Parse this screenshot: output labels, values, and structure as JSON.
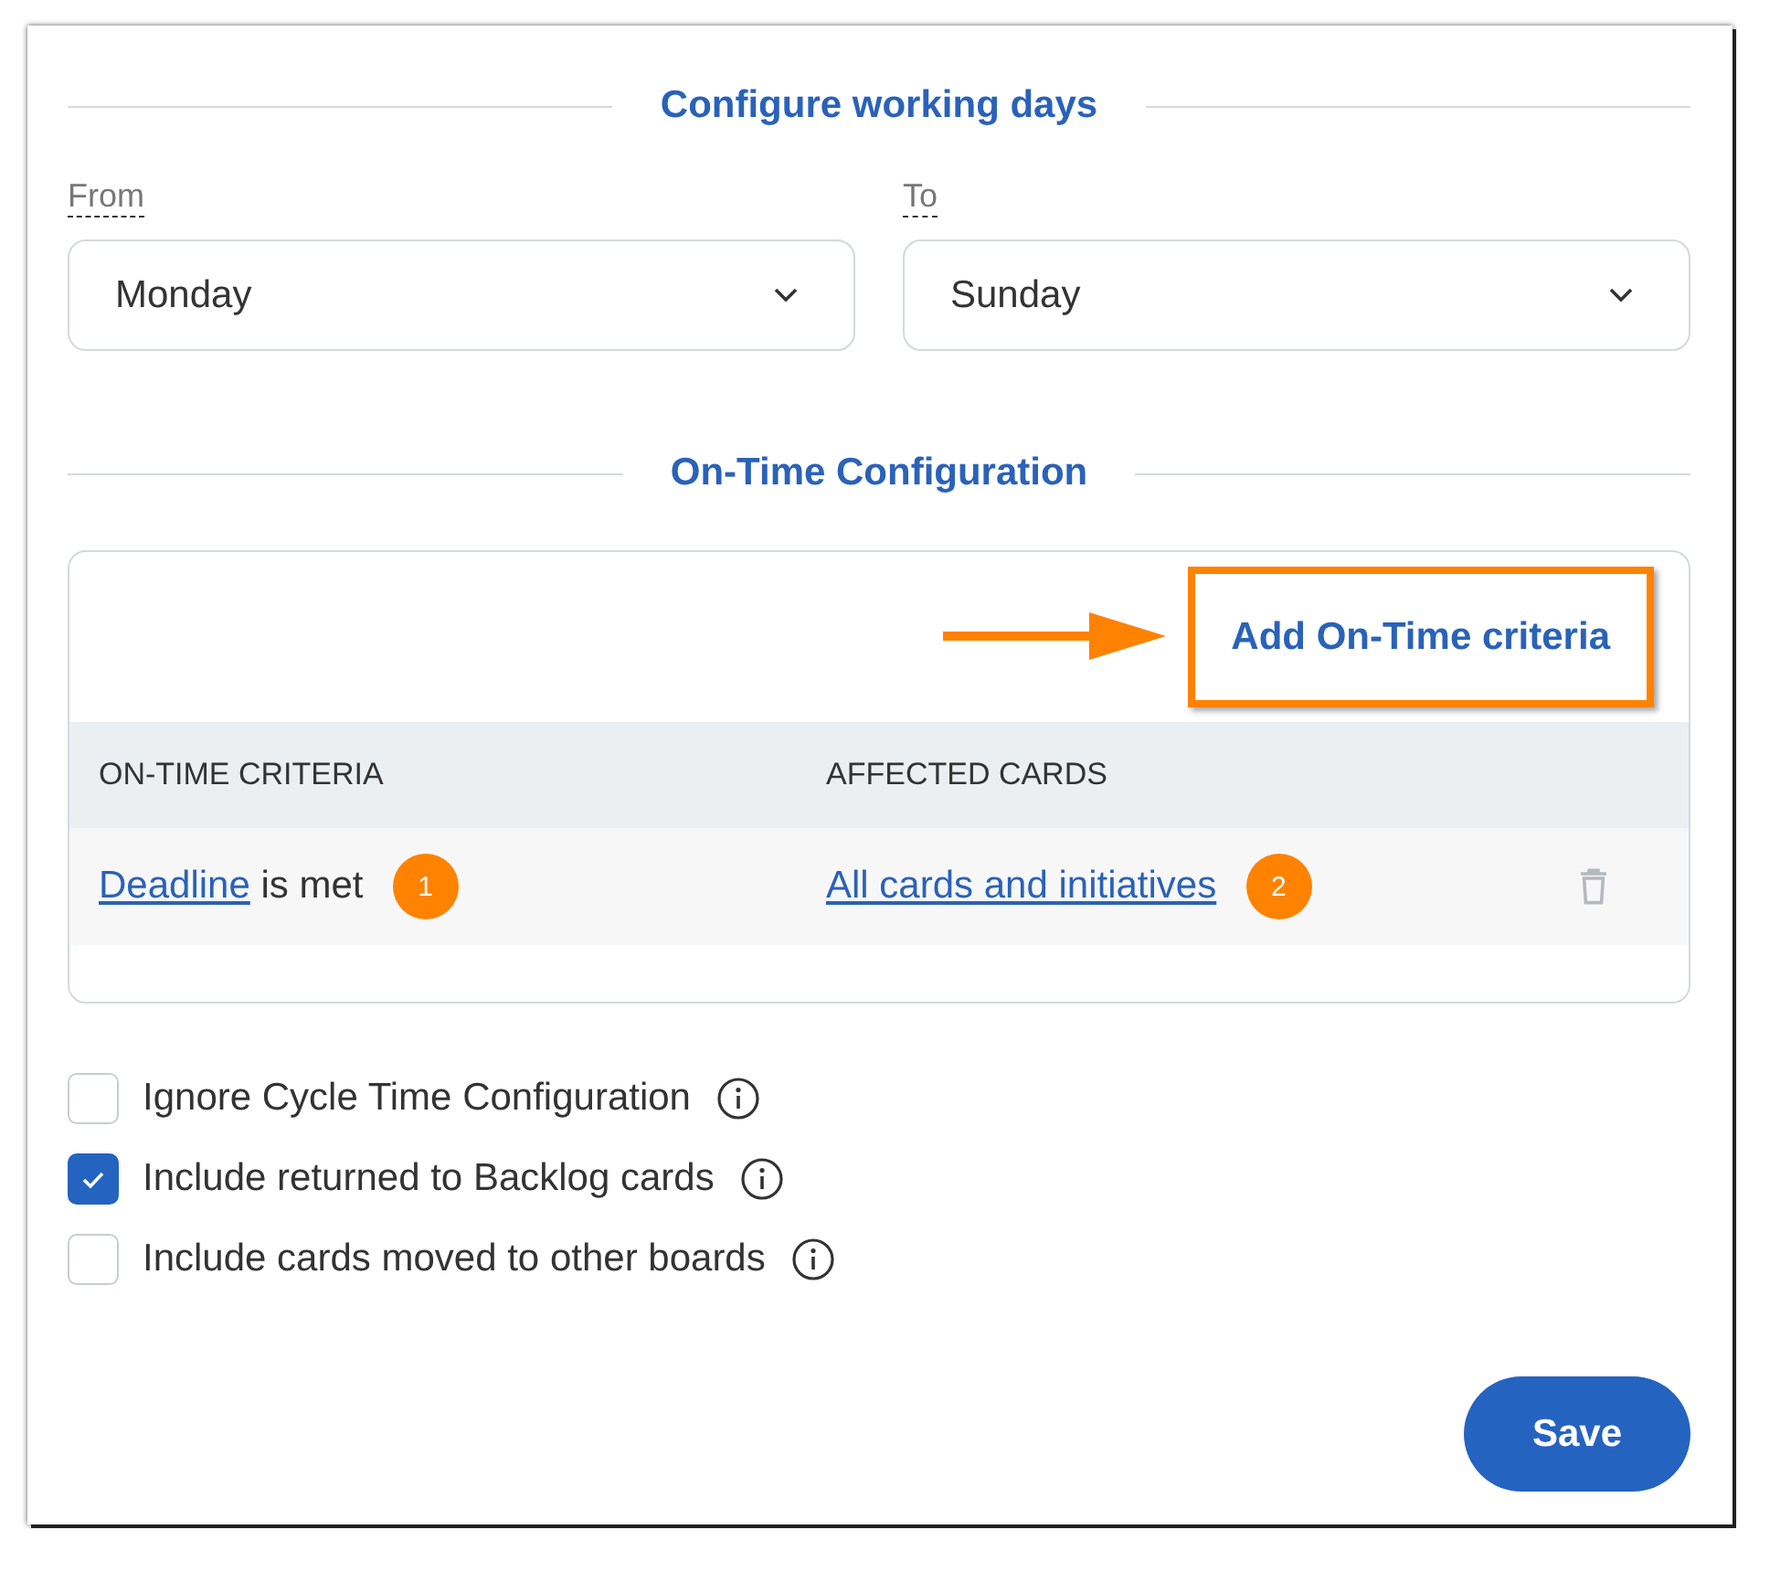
{
  "working_days": {
    "heading": "Configure working days",
    "from": {
      "label": "From",
      "value": "Monday"
    },
    "to": {
      "label": "To",
      "value": "Sunday"
    }
  },
  "on_time": {
    "heading": "On-Time Configuration",
    "add_button": {
      "label": "Add On-Time criteria",
      "highlighted": true
    },
    "table": {
      "columns": [
        "ON-TIME CRITERIA",
        "AFFECTED CARDS"
      ],
      "rows": [
        {
          "criteria_link": "Deadline",
          "criteria_text": "is met",
          "criteria_badge": "1",
          "affected_link": "All cards and initiatives",
          "affected_badge": "2"
        }
      ]
    }
  },
  "options": [
    {
      "label": "Ignore Cycle Time Configuration",
      "checked": false
    },
    {
      "label": "Include returned to Backlog cards",
      "checked": true
    },
    {
      "label": "Include cards moved to other boards",
      "checked": false
    }
  ],
  "save_button": "Save"
}
